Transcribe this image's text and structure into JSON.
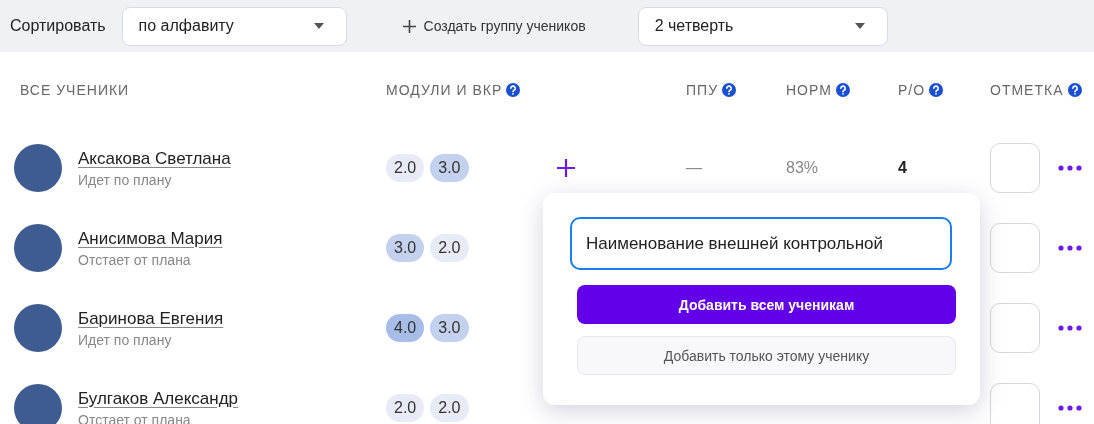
{
  "toolbar": {
    "sort_label": "Сортировать",
    "sort_select": "по алфавиту",
    "create_group": "Создать группу учеников",
    "period_select": "2 четверть"
  },
  "table": {
    "columns": [
      {
        "label": "ВСЕ УЧЕНИКИ",
        "help": false
      },
      {
        "label": "МОДУЛИ И ВКР",
        "help": true
      },
      {
        "label": "ППУ",
        "help": true
      },
      {
        "label": "НОРМ",
        "help": true
      },
      {
        "label": "Р/О",
        "help": true
      },
      {
        "label": "ОТМЕТКА",
        "help": true
      }
    ],
    "rows": [
      {
        "name": "Аксакова Светлана",
        "status": "Идет по плану",
        "modules": [
          {
            "value": "2.0",
            "color": "#e6ebf6"
          },
          {
            "value": "3.0",
            "color": "#c3d1ee"
          }
        ],
        "add": true,
        "ppu": "—",
        "norm": "83%",
        "ro": "4"
      },
      {
        "name": "Анисимова Мария",
        "status": "Отстает от плана",
        "modules": [
          {
            "value": "3.0",
            "color": "#c3d1ee"
          },
          {
            "value": "2.0",
            "color": "#e6ebf6"
          }
        ],
        "add": false
      },
      {
        "name": "Баринова Евгения",
        "status": "Идет по плану",
        "modules": [
          {
            "value": "4.0",
            "color": "#a7bde8"
          },
          {
            "value": "3.0",
            "color": "#c3d1ee"
          }
        ],
        "add": false
      },
      {
        "name": "Булгаков Александр",
        "status": "Отстает от плана",
        "modules": [
          {
            "value": "2.0",
            "color": "#e6ebf6"
          },
          {
            "value": "2.0",
            "color": "#e6ebf6"
          }
        ],
        "add": false
      }
    ]
  },
  "popup": {
    "input_value": "Наименование внешней контрольной",
    "primary_button": "Добавить всем ученикам",
    "secondary_button": "Добавить только этому ученику"
  }
}
